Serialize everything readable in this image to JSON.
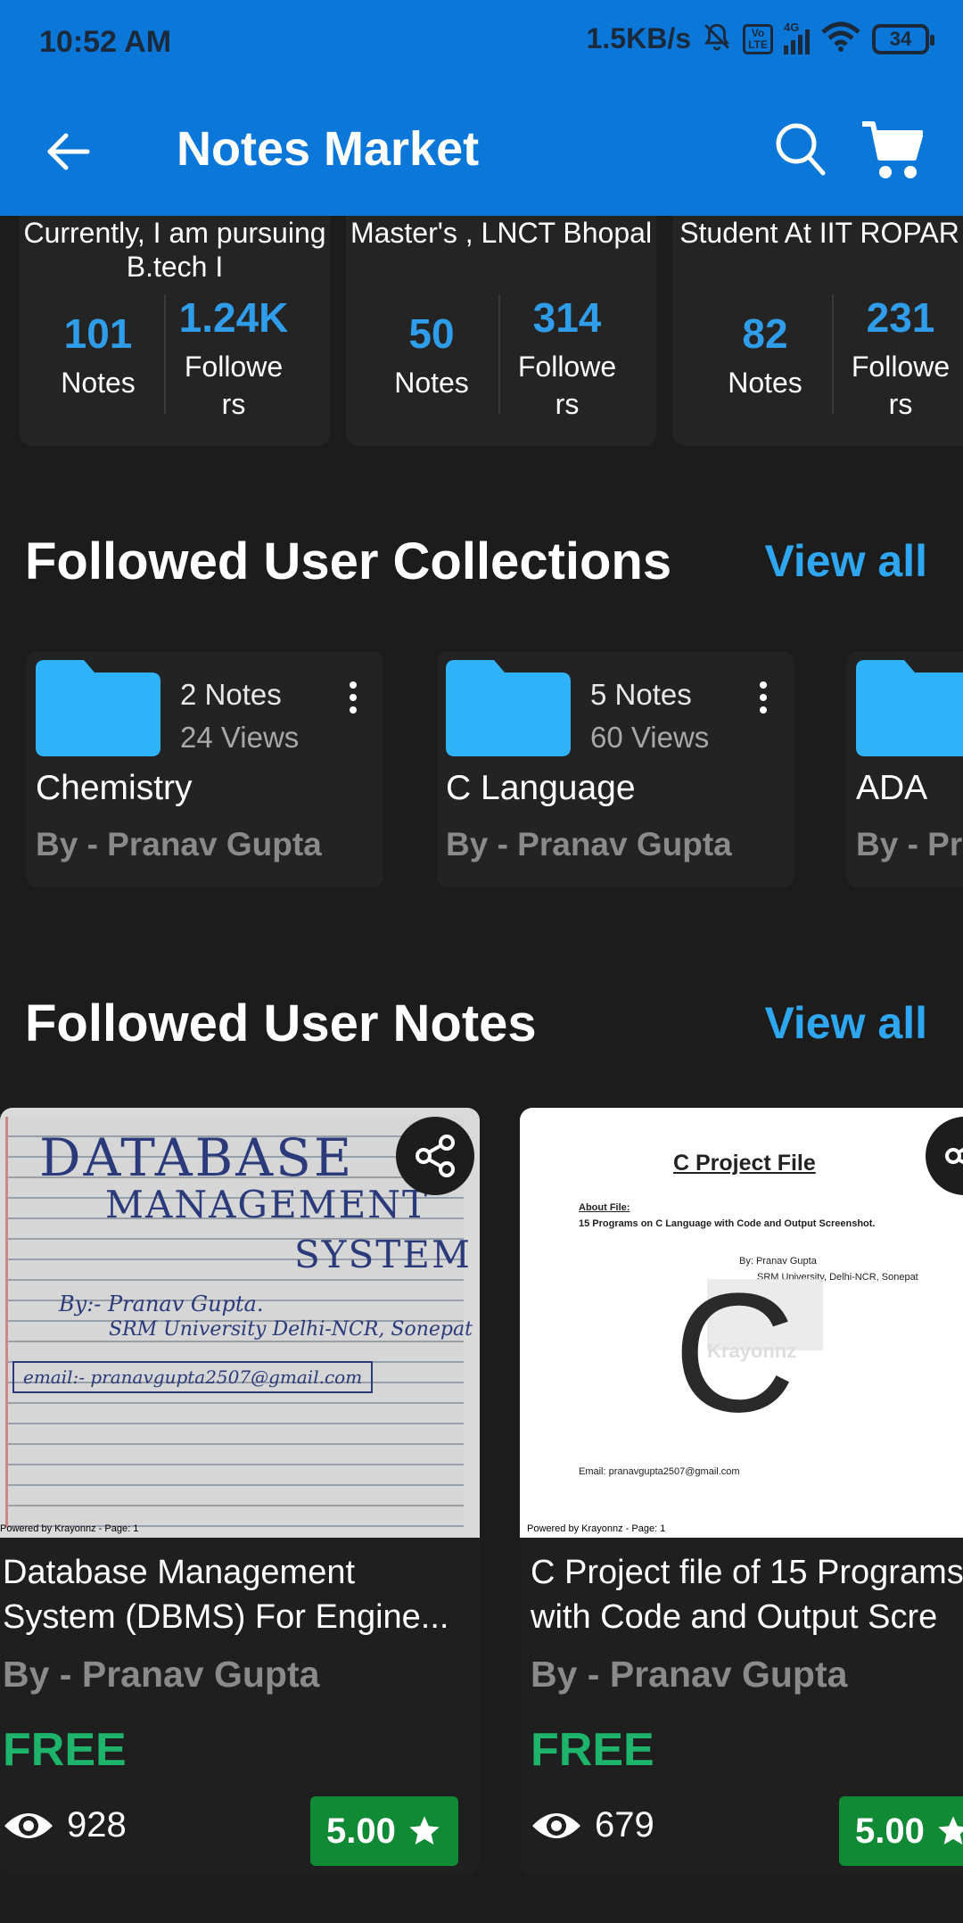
{
  "status_bar": {
    "time": "10:52 AM",
    "speed": "1.5KB/s",
    "volte": "Vo LTE",
    "network": "4G",
    "battery": "34"
  },
  "toolbar": {
    "title": "Notes Market",
    "icons": [
      "back-arrow-icon",
      "search-icon",
      "cart-icon"
    ]
  },
  "profiles": [
    {
      "description": "Currently, I am pursuing B.tech I",
      "notes_value": "101",
      "notes_label": "Notes",
      "followers_value": "1.24K",
      "followers_label": "Followe rs"
    },
    {
      "description": "Master's , LNCT Bhopal",
      "notes_value": "50",
      "notes_label": "Notes",
      "followers_value": "314",
      "followers_label": "Followe rs"
    },
    {
      "description": "Student At  IIT ROPAR",
      "notes_value": "82",
      "notes_label": "Notes",
      "followers_value": "231",
      "followers_label": "Followe rs"
    }
  ],
  "collections_section": {
    "title": "Followed User Collections",
    "view_all": "View all",
    "items": [
      {
        "name": "Chemistry",
        "notes": "2 Notes",
        "views": "24 Views",
        "author": "By - Pranav Gupta"
      },
      {
        "name": "C Language",
        "notes": "5 Notes",
        "views": "60 Views",
        "author": "By - Pranav Gupta"
      },
      {
        "name": "ADA",
        "notes": "",
        "views": "",
        "author": "By - Pranav Gupta"
      }
    ]
  },
  "notes_section": {
    "title": "Followed User Notes",
    "view_all": "View all",
    "items": [
      {
        "title": "Database Management System (DBMS) For Engine...",
        "author": "By - Pranav Gupta",
        "price": "FREE",
        "views": "928",
        "rating": "5.00",
        "thumbnail": {
          "line1": "DATABASE",
          "line2": "MANAGEMENT",
          "line3": "SYSTEM",
          "by": "By:- Pranav Gupta.",
          "university": "SRM University Delhi-NCR, Sonepat",
          "email": "email:- pranavgupta2507@gmail.com",
          "footer": "Powered by Krayonnz - Page: 1"
        }
      },
      {
        "title": "C Project file of 15 Programs with Code and Output Scre",
        "author": "By - Pranav Gupta",
        "price": "FREE",
        "views": "679",
        "rating": "5.00",
        "thumbnail": {
          "heading": "C Project File",
          "about": "About File:",
          "about_desc": "15 Programs on C Language with Code and Output Screenshot.",
          "by": "By: Pranav Gupta",
          "university": "SRM University, Delhi-NCR, Sonepat",
          "big_letter": "C",
          "watermark": "Krayonnz",
          "email": "Email: pranavgupta2507@gmail.com",
          "footer": "Powered by Krayonnz - Page: 1"
        }
      }
    ]
  },
  "colors": {
    "header": "#0b77d9",
    "background": "#1c1c1c",
    "accent": "#2fa6f0",
    "price": "#1fb46b",
    "rating": "#118a35",
    "folder": "#2fb2f7"
  }
}
